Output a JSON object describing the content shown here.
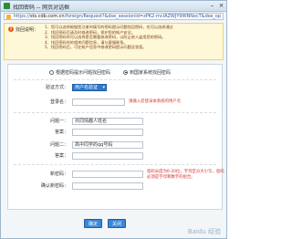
{
  "window": {
    "title": "找回密码 -- 网页对话框",
    "url_prefix": "https://",
    "url_domain": "sts.cdb.com.cn",
    "url_rest": "/foreign/Request?&dse_sessionId=zPK2-mcIAZWJY9WNNxcT&dse_op"
  },
  "notice": {
    "label": "找回说明：",
    "items": [
      "1、您可以选择根据您注册时填写的密码提示问题找回密码，也可以选择通过",
      "2、找回密码后请及时修改密码，保护您的帐户安全。",
      "3、找回密码时可以选择是否需要修改密码，以防止他人盗用您的密码。",
      "4、找回密码时的相关问题信息，请与客服联系。",
      "5、找回密码后，可在帐户信息中修改密码提示问题及答案。"
    ]
  },
  "form": {
    "radio_option_1": "根据密码提示问题找回密码",
    "radio_option_2": "到国家系统找回密码",
    "verify_method_label": "验证方式：",
    "verify_method_value": "用户名验证",
    "login_name_label": "登录名：",
    "login_name_hint": "请输入您登录本系统的用户名",
    "question1_label": "问题一：",
    "question1_value": "共同情趣人姓名",
    "answer1_label": "答案：",
    "question2_label": "问题二：",
    "question2_value": "高中同学的qq号码",
    "answer2_label": "答案：",
    "new_password_label": "新密码：",
    "new_password_hint_1": "密码长度为6-20位，字母区分大小写，密码",
    "new_password_hint_2": "必须是字母和数字的组合。",
    "confirm_password_label": "确认新密码："
  },
  "buttons": {
    "ok": "确定",
    "close": "关闭"
  },
  "watermark": "Baidu 经验"
}
